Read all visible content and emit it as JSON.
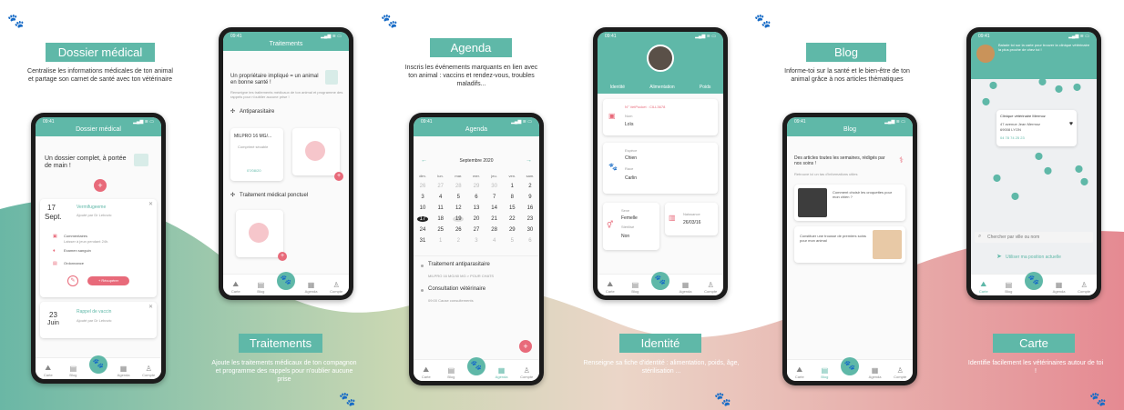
{
  "colors": {
    "accent": "#5fb8a8",
    "pink": "#e86a7a"
  },
  "p1": {
    "title": "Dossier médical",
    "desc": "Centralise les informations médicales de ton animal et partage son carnet de santé avec ton vétérinaire",
    "time": "09:41",
    "header": "Dossier médical",
    "intro": "Un dossier complet, à portée de main !",
    "e1": {
      "day": "17",
      "month": "Sept.",
      "title": "Vermifugeeme",
      "sub": "Ajouté par Dr Lebovic",
      "i1": "Commentaires",
      "i1s": "Laisser à jeun pendant 24h.",
      "i2": "Examen sanguin",
      "i3": "Ordonnance",
      "btn": "+ Récupérer"
    },
    "e2": {
      "day": "23",
      "month": "Juin",
      "title": "Rappel de vaccin",
      "sub": "Ajouté par Dr Lebovic"
    }
  },
  "p2": {
    "time": "09:41",
    "header": "Traitements",
    "intro": "Un propriétaire impliqué = un animal en bonne santé !",
    "sub": "Renseigne tes traitements médicaux de ton animal et programme des rappels pour n'oublier aucune prise !",
    "s1": "Antiparasitaire",
    "card1": "MILPRO 16 MG/...",
    "card1s": "Comprimé sécable",
    "card1d": "07/08/20",
    "s2": "Traitement médical ponctuel",
    "title": "Traitements",
    "desc": "Ajoute les traitements médicaux de ton compagnon et programme des rappels pour n'oublier aucune prise"
  },
  "p3": {
    "title": "Agenda",
    "desc": "Inscris les événements marquants en lien avec ton animal : vaccins et rendez-vous, troubles maladifs...",
    "time": "09:41",
    "header": "Agenda",
    "month": "Septembre 2020",
    "days": [
      "dim.",
      "lun.",
      "mar.",
      "mer.",
      "jeu.",
      "ven.",
      "sam."
    ],
    "weeks": [
      [
        "26",
        "27",
        "28",
        "29",
        "30",
        "1",
        "2"
      ],
      [
        "3",
        "4",
        "5",
        "6",
        "7",
        "8",
        "9"
      ],
      [
        "10",
        "11",
        "12",
        "13",
        "14",
        "15",
        "16"
      ],
      [
        "17",
        "18",
        "19",
        "20",
        "21",
        "22",
        "23"
      ],
      [
        "24",
        "25",
        "26",
        "27",
        "28",
        "29",
        "30"
      ],
      [
        "31",
        "1",
        "2",
        "3",
        "4",
        "5",
        "6"
      ]
    ],
    "ev1": "Traitement antiparasitaire",
    "ev1s": "MILPRO 16 MG/40 MG > POUR CHATS",
    "ev2": "Consultation vétérinaire",
    "ev2s": "09:00   Cause consultements"
  },
  "p4": {
    "time": "09:41",
    "tabs": [
      "Identité",
      "Alimentation",
      "Poids"
    ],
    "puce": "N° VetPocket : CILL3678",
    "nomL": "Nom",
    "nom": "Loïs",
    "espL": "Espèce",
    "esp": "Chien",
    "raceL": "Race",
    "race": "Carlin",
    "sexeL": "Sexe",
    "sexe": "Femelle",
    "sterL": "Stérilisé",
    "ster": "Non",
    "naisL": "Naissance",
    "nais": "26/03/16",
    "title": "Identité",
    "desc": "Renseigne sa fiche d'identité : alimentation, poids, âge, stérilisation ..."
  },
  "p5": {
    "title": "Blog",
    "desc": "Informe-toi sur la santé et le bien-être de ton animal grâce à nos articles thématiques",
    "time": "09:41",
    "header": "Blog",
    "intro": "Des articles toutes les semaines, rédigés par nos soins !",
    "sub": "Retrouve ici un tas d'informations utiles",
    "a1": "Comment choisir les croquettes pour mon chien ?",
    "a2": "Constituer une trousse de premiers soins pour mon animal"
  },
  "p6": {
    "time": "09:41",
    "bubble": "Balade toi sur la carte pour trouver la clinique vétérinaire la plus proche de chez toi !",
    "clinic": "Clinique vétérinaire Mermoz",
    "addr1": "47 avenue Jean Mermoz",
    "addr2": "69008 LYON",
    "phone": "04 78 74 25 23",
    "search": "Chercher par ville ou nom",
    "pos": "Utiliser ma position actuelle",
    "title": "Carte",
    "desc": "Identifie facilement les vétérinaires autour de toi !"
  },
  "nav": {
    "carte": "Carte",
    "blog": "Blog",
    "agenda": "Agenda",
    "compte": "Compte"
  }
}
